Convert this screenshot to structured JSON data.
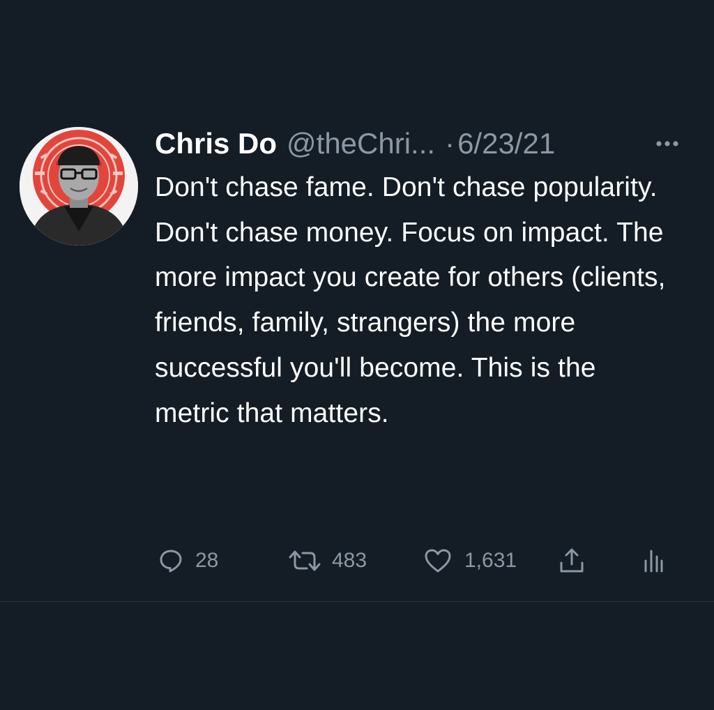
{
  "tweet": {
    "display_name": "Chris Do",
    "handle": "@theChri...",
    "separator": "·",
    "date": "6/23/21",
    "text": "Don't chase fame. Don't chase popularity. Don't chase money. Focus on impact. The more impact you create for others (clients, friends, family, strangers) the more successful you'll become. This is the metric that matters.",
    "avatar_icon": "profile-photo",
    "more_icon": "more-dots-icon"
  },
  "actions": {
    "reply": {
      "icon": "reply-icon",
      "count": "28"
    },
    "retweet": {
      "icon": "retweet-icon",
      "count": "483"
    },
    "like": {
      "icon": "heart-icon",
      "count": "1,631"
    },
    "share": {
      "icon": "share-icon"
    },
    "analytics": {
      "icon": "analytics-icon"
    }
  },
  "colors": {
    "background": "#141d26",
    "text_primary": "#ffffff",
    "text_secondary": "#8b98a5",
    "avatar_accent": "#e2453c"
  }
}
